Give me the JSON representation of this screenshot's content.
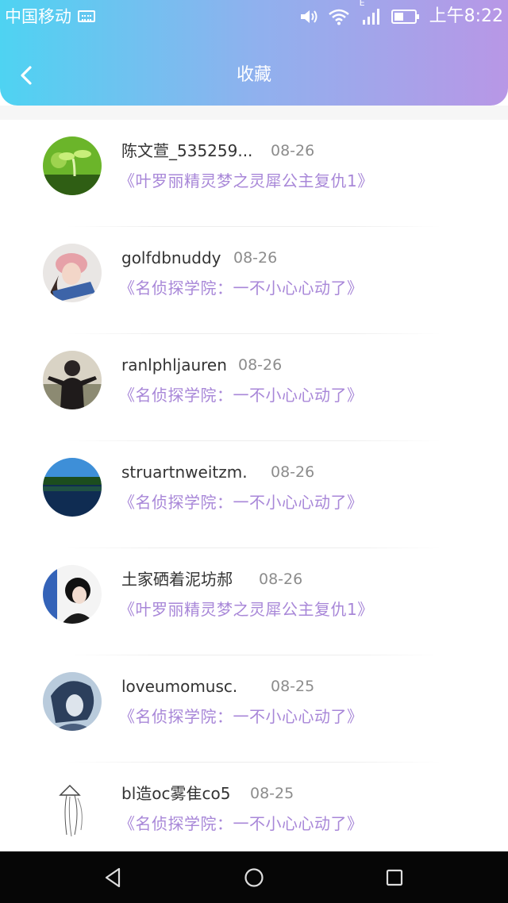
{
  "status_bar": {
    "carrier": "中国移动",
    "network_label": "E",
    "time": "上午8:22"
  },
  "header": {
    "title": "收藏"
  },
  "items": [
    {
      "name": "陈文萱_535259...",
      "date": "08-26",
      "book": "《叶罗丽精灵梦之灵犀公主复仇1》"
    },
    {
      "name": "golfdbnuddy",
      "date": "08-26",
      "book": "《名侦探学院：一不小心心动了》"
    },
    {
      "name": "ranlphljauren",
      "date": "08-26",
      "book": "《名侦探学院：一不小心心动了》"
    },
    {
      "name": "struartnweitzm.",
      "date": "08-26",
      "book": "《名侦探学院：一不小心心动了》"
    },
    {
      "name": "土家硒着泥坊郝",
      "date": "08-26",
      "book": "《叶罗丽精灵梦之灵犀公主复仇1》"
    },
    {
      "name": "loveumomusc.",
      "date": "08-25",
      "book": "《名侦探学院：一不小心心动了》"
    },
    {
      "name": "bl造oc雾隹co5",
      "date": "08-25",
      "book": "《名侦探学院：一不小心心动了》"
    }
  ],
  "colors": {
    "header_gradient_start": "#4ed3f2",
    "header_gradient_end": "#b897e6",
    "book_title": "#a887d8",
    "date": "#8c8c8c"
  }
}
